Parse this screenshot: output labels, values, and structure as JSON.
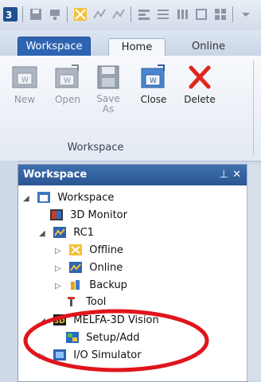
{
  "tabs": [
    "Workspace",
    "Home",
    "Online"
  ],
  "ribbon": {
    "buttons": [
      {
        "label": "New",
        "enabled": false
      },
      {
        "label": "Open",
        "enabled": false
      },
      {
        "label": "Save\nAs",
        "enabled": false
      },
      {
        "label": "Close",
        "enabled": true
      },
      {
        "label": "Delete",
        "enabled": true
      }
    ],
    "group_label": "Workspace"
  },
  "panel": {
    "title": "Workspace",
    "pin": "⊥",
    "close": "✕"
  },
  "tree": [
    {
      "label": "Workspace",
      "expander": "◢",
      "icon": "workspace-icon"
    },
    {
      "label": "3D Monitor",
      "expander": "",
      "icon": "3d-monitor-icon"
    },
    {
      "label": "RC1",
      "expander": "◢",
      "icon": "rc-icon"
    },
    {
      "label": "Offline",
      "expander": "▷",
      "icon": "offline-icon"
    },
    {
      "label": "Online",
      "expander": "▷",
      "icon": "online-icon"
    },
    {
      "label": "Backup",
      "expander": "▷",
      "icon": "backup-icon"
    },
    {
      "label": "Tool",
      "expander": "",
      "icon": "tool-icon"
    },
    {
      "label": "MELFA-3D Vision",
      "expander": "◢",
      "icon": "3d-vision-icon"
    },
    {
      "label": "Setup/Add",
      "expander": "",
      "icon": "setup-add-icon"
    },
    {
      "label": "I/O Simulator",
      "expander": "▷",
      "icon": "io-simulator-icon"
    }
  ],
  "colors": {
    "accent": "#2f64b2",
    "annotation": "#e0141c"
  }
}
